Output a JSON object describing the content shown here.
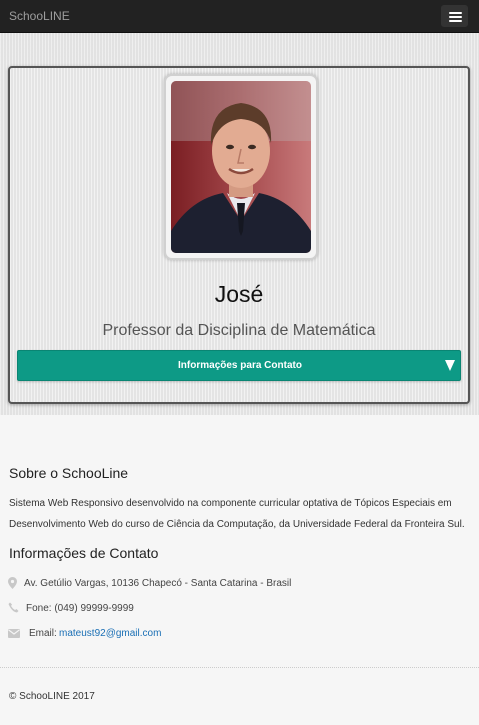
{
  "navbar": {
    "brand": "SchooLINE",
    "menu_icon": "hamburger-menu-icon"
  },
  "profile": {
    "photo_icon": "profile-photo",
    "name": "José",
    "subtitle": "Professor da Disciplina de Matemática",
    "contact_button_label": "Informações para Contato",
    "contact_button_icon": "caret-down-icon",
    "accent_color": "#0d9a86"
  },
  "about": {
    "heading": "Sobre o SchooLine",
    "text": "Sistema Web Responsivo desenvolvido na componente curricular optativa de Tópicos Especiais em Desenvolvimento Web do curso de Ciência da Computação, da Universidade Federal da Fronteira Sul."
  },
  "contact_info": {
    "heading": "Informações de Contato",
    "address": "Av. Getúlio Vargas, 10136 Chapecó - Santa Catarina - Brasil",
    "phone": "Fone: (049) 99999-9999",
    "email_label": "Email:",
    "email": "mateust92@gmail.com",
    "link_color": "#1a6fb5"
  },
  "footer": {
    "copyright": "© SchooLINE 2017"
  }
}
